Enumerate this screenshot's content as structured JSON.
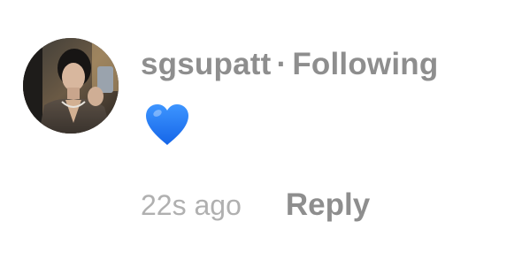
{
  "comment": {
    "username": "sgsupatt",
    "separator": "·",
    "follow_status": "Following",
    "body_emoji": "💙",
    "body_icon": "blue-heart-icon",
    "timestamp": "22s ago",
    "reply_label": "Reply"
  },
  "colors": {
    "text_gray": "#8e8e8e",
    "timestamp_gray": "#b0b0b0",
    "heart_blue": "#1f7cf5",
    "background": "#ffffff"
  }
}
